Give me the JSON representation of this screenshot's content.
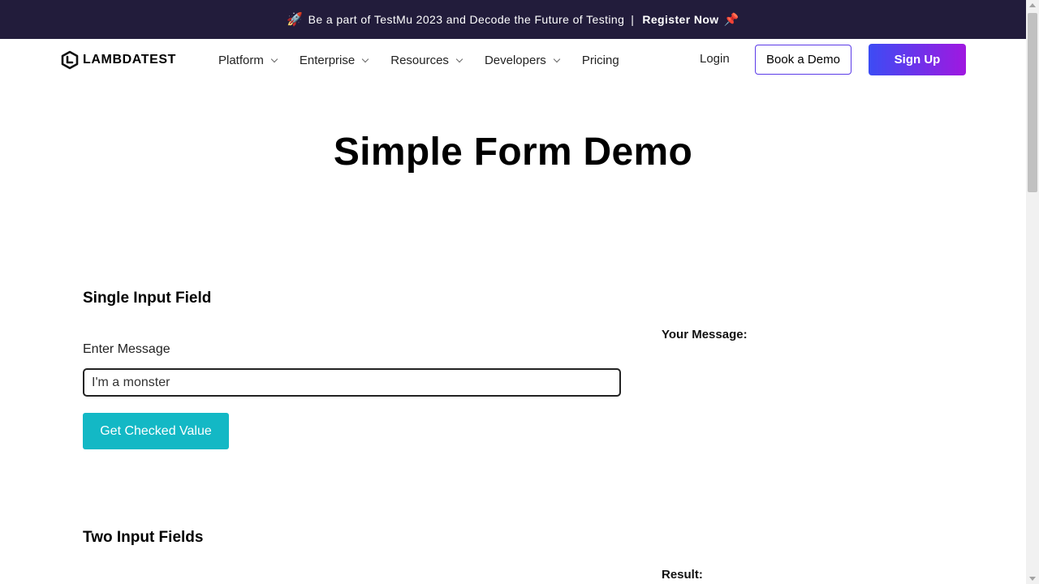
{
  "banner": {
    "rocket_icon": "rocket-icon",
    "text": "Be a part of TestMu 2023 and Decode the Future of Testing",
    "separator": "|",
    "cta": "Register Now",
    "pin_icon": "pushpin-icon"
  },
  "header": {
    "logo_text": "LAMBDATEST",
    "nav": [
      {
        "label": "Platform",
        "has_dropdown": true
      },
      {
        "label": "Enterprise",
        "has_dropdown": true
      },
      {
        "label": "Resources",
        "has_dropdown": true
      },
      {
        "label": "Developers",
        "has_dropdown": true
      },
      {
        "label": "Pricing",
        "has_dropdown": false
      }
    ],
    "login": "Login",
    "book_demo": "Book a Demo",
    "signup": "Sign Up"
  },
  "main": {
    "title": "Simple Form Demo",
    "single_input": {
      "heading": "Single Input Field",
      "label": "Enter Message",
      "value": "I'm a monster",
      "button": "Get Checked Value",
      "result_label": "Your Message:"
    },
    "two_inputs": {
      "heading": "Two Input Fields",
      "result_label": "Result:"
    }
  },
  "colors": {
    "banner_bg": "#221c3b",
    "button_teal": "#13b8c5",
    "signup_gradient_start": "#3c4cf4",
    "signup_gradient_end": "#a018e0"
  }
}
